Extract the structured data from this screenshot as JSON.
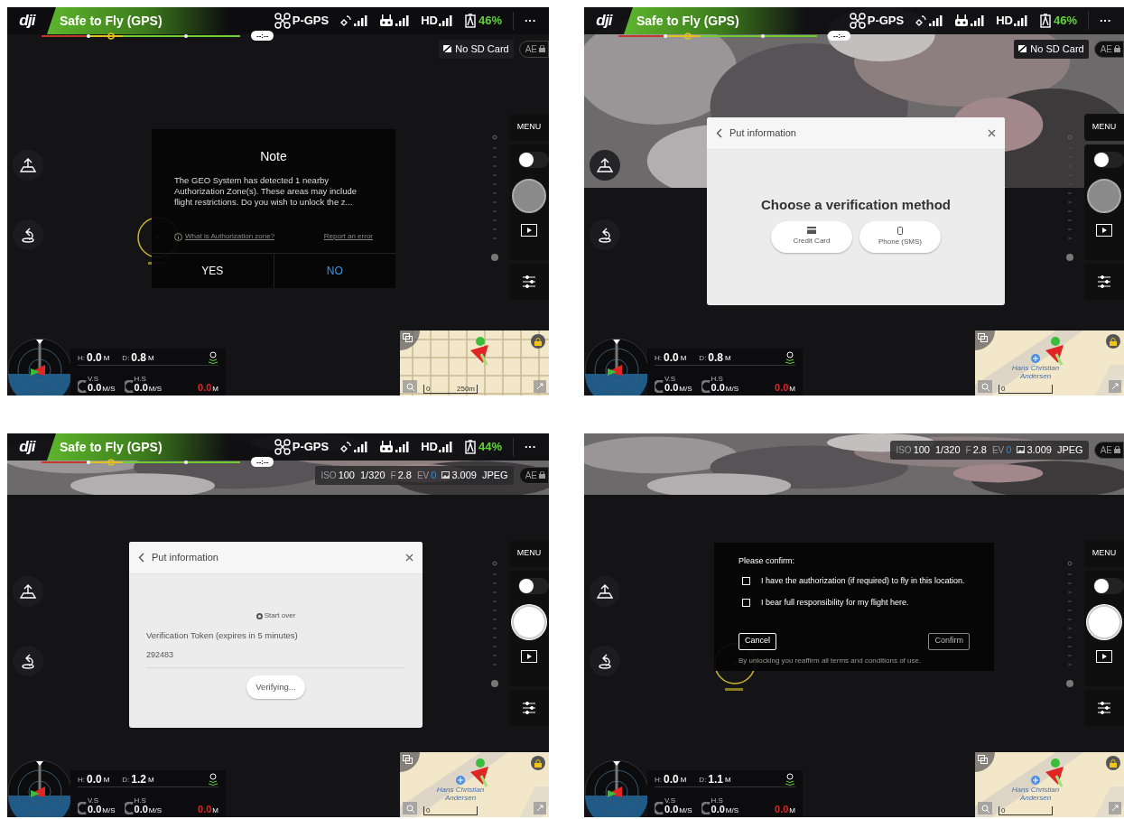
{
  "screens": [
    {
      "status_bar": {
        "logo": "dji",
        "flight_status": "Safe to Fly (GPS)",
        "flight_time": "--:--",
        "mode": "P-GPS",
        "hd": "HD",
        "battery": "46%",
        "more": "···"
      },
      "storage_badge": "No SD Card",
      "ae_lock": {
        "label": "AE"
      },
      "menu_label": "MENU",
      "mode_toggle": {
        "on": false
      },
      "shutter": {
        "active": false
      },
      "hotspot_marker": true,
      "dialog": {
        "kind": "note",
        "title": "Note",
        "message": "The GEO System has detected 1 nearby Authorization Zone(s). These areas may include flight restrictions. Do you wish to unlock the z...",
        "links": [
          "What is Authorization zone?",
          "Report an error"
        ],
        "buttons": [
          {
            "label": "YES",
            "highlighted": false
          },
          {
            "label": "NO",
            "highlighted": true
          }
        ]
      },
      "telemetry": [
        {
          "kind": "distance",
          "label": "H:",
          "value": "0.0",
          "unit": "M"
        },
        {
          "kind": "distance",
          "label": "D:",
          "value": "0.8",
          "unit": "M"
        },
        {
          "kind": "speed",
          "label": "V.S",
          "value": "0.0",
          "unit": "M/S"
        },
        {
          "kind": "speed",
          "label": "H.S",
          "value": "0.0",
          "unit": "M/S"
        },
        {
          "kind": "warning",
          "value": "0.0",
          "unit": "M"
        }
      ],
      "map": {
        "kind": "grid",
        "scale": [
          "0",
          "250m"
        ]
      }
    },
    {
      "camera_feed": {
        "kind": "upper"
      },
      "status_bar": {
        "logo": "dji",
        "flight_status": "Safe to Fly (GPS)",
        "flight_time": "--:--",
        "mode": "P-GPS",
        "hd": "HD",
        "battery": "46%",
        "more": "···"
      },
      "storage_badge": "No SD Card",
      "ae_lock": {
        "label": "AE"
      },
      "menu_label": "MENU",
      "mode_toggle": {
        "on": false
      },
      "shutter": {
        "active": false
      },
      "dialog": {
        "kind": "choice",
        "title": "Put information",
        "heading": "Choose a verification method",
        "options": [
          {
            "kind": "card",
            "label": "Credit Card"
          },
          {
            "kind": "phone",
            "label": "Phone (SMS)"
          }
        ]
      },
      "telemetry": [
        {
          "kind": "distance",
          "label": "H:",
          "value": "0.0",
          "unit": "M"
        },
        {
          "kind": "distance",
          "label": "D:",
          "value": "0.8",
          "unit": "M"
        },
        {
          "kind": "speed",
          "label": "V.S",
          "value": "0.0",
          "unit": "M/S"
        },
        {
          "kind": "speed",
          "label": "H.S",
          "value": "0.0",
          "unit": "M/S"
        },
        {
          "kind": "warning",
          "value": "0.0",
          "unit": "M"
        }
      ],
      "map": {
        "kind": "street",
        "place": "Hans Christian Andersen",
        "scale": [
          "0"
        ]
      }
    },
    {
      "camera_feed": {
        "kind": "strip"
      },
      "status_bar": {
        "logo": "dji",
        "flight_status": "Safe to Fly (GPS)",
        "flight_time": "--:--",
        "mode": "P-GPS",
        "hd": "HD",
        "battery": "44%",
        "more": "···"
      },
      "camera_settings": [
        {
          "kind": "plain",
          "label": "ISO",
          "value": "100"
        },
        {
          "kind": "plain",
          "value": "1/320"
        },
        {
          "kind": "plain",
          "label": "F",
          "value": "2.8"
        },
        {
          "kind": "accent",
          "label": "EV",
          "value": "0"
        },
        {
          "kind": "count",
          "value": "3.009"
        },
        {
          "kind": "plain",
          "value": "JPEG"
        }
      ],
      "ae_lock": {
        "label": "AE"
      },
      "menu_label": "MENU",
      "mode_toggle": {
        "on": false
      },
      "shutter": {
        "active": true
      },
      "dialog": {
        "kind": "token",
        "title": "Put information",
        "start_over": "Start over",
        "token_label": "Verification Token (expires in 5 minutes)",
        "token_value": "292483",
        "button": "Verifying..."
      },
      "telemetry": [
        {
          "kind": "distance",
          "label": "H:",
          "value": "0.0",
          "unit": "M"
        },
        {
          "kind": "distance",
          "label": "D:",
          "value": "1.2",
          "unit": "M"
        },
        {
          "kind": "speed",
          "label": "V.S",
          "value": "0.0",
          "unit": "M/S"
        },
        {
          "kind": "speed",
          "label": "H.S",
          "value": "0.0",
          "unit": "M/S"
        },
        {
          "kind": "warning",
          "value": "0.0",
          "unit": "M"
        }
      ],
      "map": {
        "kind": "street",
        "place": "Hans Christian Andersen",
        "scale": [
          "0"
        ]
      }
    },
    {
      "camera_feed": {
        "kind": "strip"
      },
      "camera_settings": [
        {
          "kind": "plain",
          "label": "ISO",
          "value": "100"
        },
        {
          "kind": "plain",
          "value": "1/320"
        },
        {
          "kind": "plain",
          "label": "F",
          "value": "2.8"
        },
        {
          "kind": "accent",
          "label": "EV",
          "value": "0"
        },
        {
          "kind": "count",
          "value": "3.009"
        },
        {
          "kind": "plain",
          "value": "JPEG"
        }
      ],
      "ae_lock": {
        "label": "AE"
      },
      "menu_label": "MENU",
      "mode_toggle": {
        "on": false
      },
      "shutter": {
        "active": true
      },
      "hotspot_marker": true,
      "dialog": {
        "kind": "confirm",
        "heading": "Please confirm:",
        "items": [
          {
            "label": "I have the authorization (if required) to fly in this location.",
            "checked": false
          },
          {
            "label": "I bear full responsibility for my flight here.",
            "checked": false
          }
        ],
        "buttons": [
          {
            "label": "Cancel",
            "highlighted": true
          },
          {
            "label": "Confirm",
            "highlighted": false
          }
        ],
        "footnote": "By unlocking you reaffirm all terms and conditions of use."
      },
      "telemetry": [
        {
          "kind": "distance",
          "label": "H:",
          "value": "0.0",
          "unit": "M"
        },
        {
          "kind": "distance",
          "label": "D:",
          "value": "1.1",
          "unit": "M"
        },
        {
          "kind": "speed",
          "label": "V.S",
          "value": "0.0",
          "unit": "M/S"
        },
        {
          "kind": "speed",
          "label": "H.S",
          "value": "0.0",
          "unit": "M/S"
        },
        {
          "kind": "warning",
          "value": "0.0",
          "unit": "M"
        }
      ],
      "map": {
        "kind": "street",
        "place": "Hans Christian Andersen",
        "scale": [
          "0"
        ]
      }
    }
  ]
}
